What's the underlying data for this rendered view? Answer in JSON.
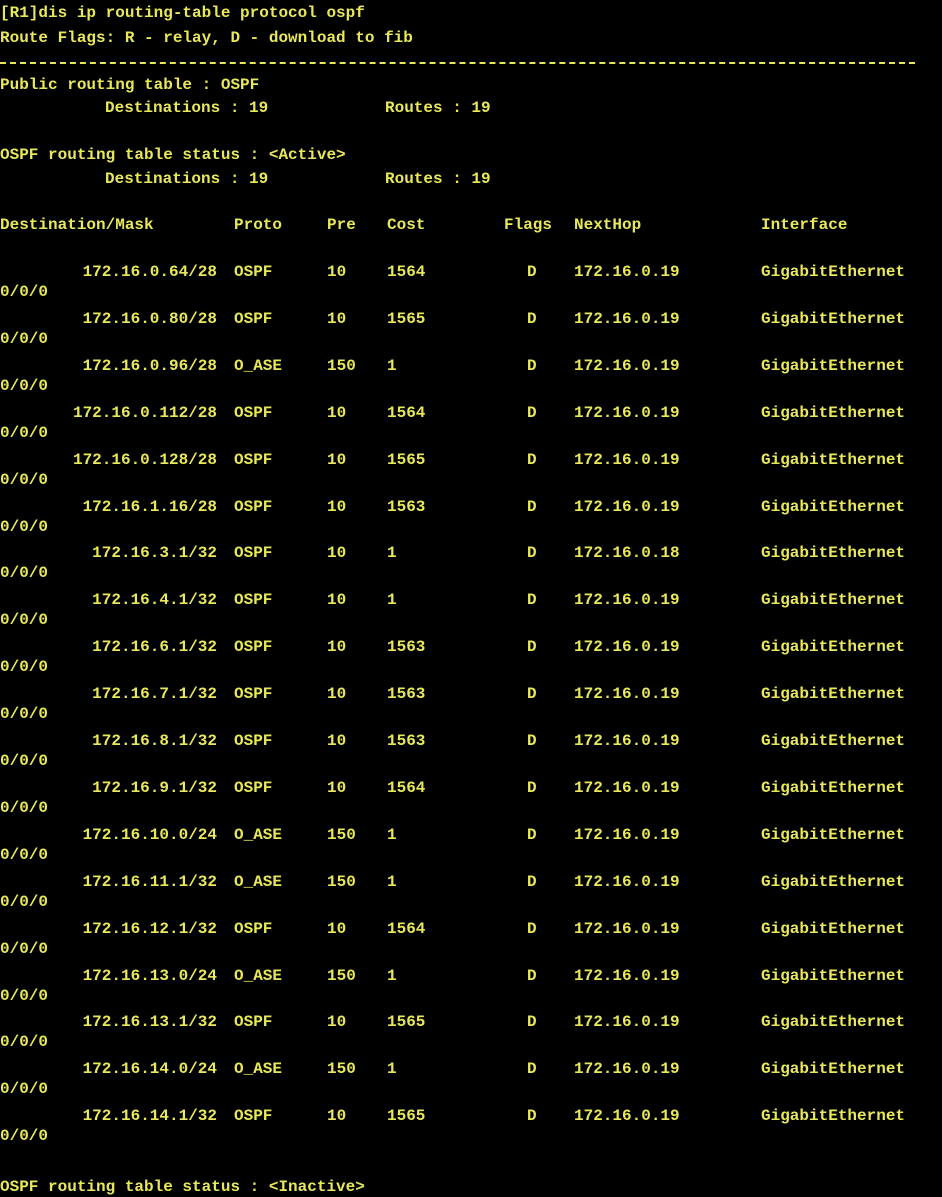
{
  "colors": {
    "background": "#000000",
    "text": "#e8e85a"
  },
  "terminal": {
    "command_line": "[R1]dis ip routing-table protocol ospf",
    "route_flags": "Route Flags: R - relay, D - download to fib",
    "public_table": "Public routing table : OSPF",
    "public_destinations": "Destinations : 19",
    "public_routes": "Routes : 19",
    "active_status": "OSPF routing table status : <Active>",
    "active_destinations": "Destinations : 19",
    "active_routes": "Routes : 19",
    "headers": {
      "destination": "Destination/Mask",
      "proto": "Proto",
      "pre": "Pre",
      "cost": "Cost",
      "flags": "Flags",
      "nexthop": "NextHop",
      "interface": "Interface"
    },
    "rows": [
      {
        "destination": "172.16.0.64/28",
        "proto": "OSPF",
        "pre": "10",
        "cost": "1564",
        "flags": "D",
        "nexthop": "172.16.0.19",
        "interface": "GigabitEthernet",
        "interface_cont": "0/0/0"
      },
      {
        "destination": "172.16.0.80/28",
        "proto": "OSPF",
        "pre": "10",
        "cost": "1565",
        "flags": "D",
        "nexthop": "172.16.0.19",
        "interface": "GigabitEthernet",
        "interface_cont": "0/0/0"
      },
      {
        "destination": "172.16.0.96/28",
        "proto": "O_ASE",
        "pre": "150",
        "cost": "1",
        "flags": "D",
        "nexthop": "172.16.0.19",
        "interface": "GigabitEthernet",
        "interface_cont": "0/0/0"
      },
      {
        "destination": "172.16.0.112/28",
        "proto": "OSPF",
        "pre": "10",
        "cost": "1564",
        "flags": "D",
        "nexthop": "172.16.0.19",
        "interface": "GigabitEthernet",
        "interface_cont": "0/0/0"
      },
      {
        "destination": "172.16.0.128/28",
        "proto": "OSPF",
        "pre": "10",
        "cost": "1565",
        "flags": "D",
        "nexthop": "172.16.0.19",
        "interface": "GigabitEthernet",
        "interface_cont": "0/0/0"
      },
      {
        "destination": "172.16.1.16/28",
        "proto": "OSPF",
        "pre": "10",
        "cost": "1563",
        "flags": "D",
        "nexthop": "172.16.0.19",
        "interface": "GigabitEthernet",
        "interface_cont": "0/0/0"
      },
      {
        "destination": "172.16.3.1/32",
        "proto": "OSPF",
        "pre": "10",
        "cost": "1",
        "flags": "D",
        "nexthop": "172.16.0.18",
        "interface": "GigabitEthernet",
        "interface_cont": "0/0/0"
      },
      {
        "destination": "172.16.4.1/32",
        "proto": "OSPF",
        "pre": "10",
        "cost": "1",
        "flags": "D",
        "nexthop": "172.16.0.19",
        "interface": "GigabitEthernet",
        "interface_cont": "0/0/0"
      },
      {
        "destination": "172.16.6.1/32",
        "proto": "OSPF",
        "pre": "10",
        "cost": "1563",
        "flags": "D",
        "nexthop": "172.16.0.19",
        "interface": "GigabitEthernet",
        "interface_cont": "0/0/0"
      },
      {
        "destination": "172.16.7.1/32",
        "proto": "OSPF",
        "pre": "10",
        "cost": "1563",
        "flags": "D",
        "nexthop": "172.16.0.19",
        "interface": "GigabitEthernet",
        "interface_cont": "0/0/0"
      },
      {
        "destination": "172.16.8.1/32",
        "proto": "OSPF",
        "pre": "10",
        "cost": "1563",
        "flags": "D",
        "nexthop": "172.16.0.19",
        "interface": "GigabitEthernet",
        "interface_cont": "0/0/0"
      },
      {
        "destination": "172.16.9.1/32",
        "proto": "OSPF",
        "pre": "10",
        "cost": "1564",
        "flags": "D",
        "nexthop": "172.16.0.19",
        "interface": "GigabitEthernet",
        "interface_cont": "0/0/0"
      },
      {
        "destination": "172.16.10.0/24",
        "proto": "O_ASE",
        "pre": "150",
        "cost": "1",
        "flags": "D",
        "nexthop": "172.16.0.19",
        "interface": "GigabitEthernet",
        "interface_cont": "0/0/0"
      },
      {
        "destination": "172.16.11.1/32",
        "proto": "O_ASE",
        "pre": "150",
        "cost": "1",
        "flags": "D",
        "nexthop": "172.16.0.19",
        "interface": "GigabitEthernet",
        "interface_cont": "0/0/0"
      },
      {
        "destination": "172.16.12.1/32",
        "proto": "OSPF",
        "pre": "10",
        "cost": "1564",
        "flags": "D",
        "nexthop": "172.16.0.19",
        "interface": "GigabitEthernet",
        "interface_cont": "0/0/0"
      },
      {
        "destination": "172.16.13.0/24",
        "proto": "O_ASE",
        "pre": "150",
        "cost": "1",
        "flags": "D",
        "nexthop": "172.16.0.19",
        "interface": "GigabitEthernet",
        "interface_cont": "0/0/0"
      },
      {
        "destination": "172.16.13.1/32",
        "proto": "OSPF",
        "pre": "10",
        "cost": "1565",
        "flags": "D",
        "nexthop": "172.16.0.19",
        "interface": "GigabitEthernet",
        "interface_cont": "0/0/0"
      },
      {
        "destination": "172.16.14.0/24",
        "proto": "O_ASE",
        "pre": "150",
        "cost": "1",
        "flags": "D",
        "nexthop": "172.16.0.19",
        "interface": "GigabitEthernet",
        "interface_cont": "0/0/0"
      },
      {
        "destination": "172.16.14.1/32",
        "proto": "OSPF",
        "pre": "10",
        "cost": "1565",
        "flags": "D",
        "nexthop": "172.16.0.19",
        "interface": "GigabitEthernet",
        "interface_cont": "0/0/0"
      }
    ],
    "inactive_status": "OSPF routing table status : <Inactive>"
  }
}
